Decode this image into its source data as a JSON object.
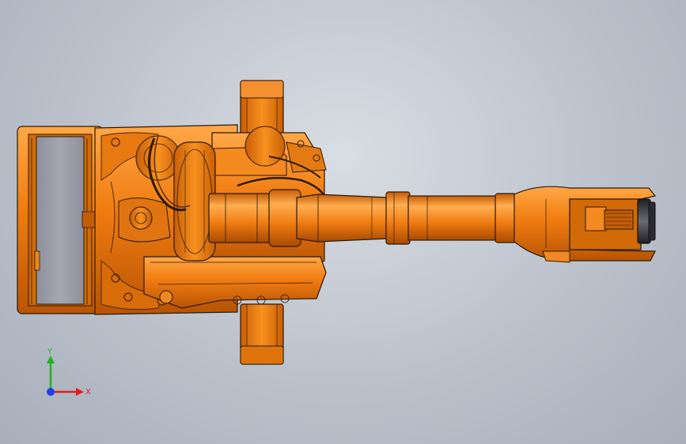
{
  "scene": {
    "background_top": "#d9dde4",
    "background_bottom": "#a8afbb",
    "part_color": "#f07c10",
    "part_shade": "#c85f05",
    "part_highlight": "#ffa040",
    "edge_color": "#2a1a08",
    "panel_color": "#9a9ca8",
    "flange_color": "#3a3a40"
  },
  "triad": {
    "x_label": "X",
    "y_label": "Y",
    "x_color": "#e02020",
    "y_color": "#20b020",
    "z_color": "#2040e0"
  }
}
